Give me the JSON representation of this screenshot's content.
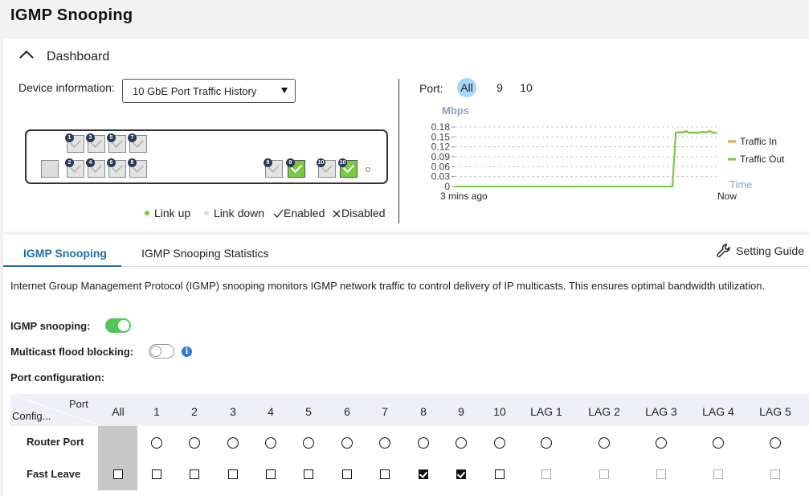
{
  "page_title": "IGMP  Snooping",
  "dashboard": {
    "title": "Dashboard",
    "device_info_label": "Device  information:",
    "device_select_value": "10  GbE  Port  Traffic  History",
    "legend": {
      "link_up": "Link  up",
      "link_down": "Link  down",
      "enabled": "Enabled",
      "disabled": "Disabled"
    },
    "ports": [
      "1",
      "2",
      "3",
      "4",
      "5",
      "6",
      "7",
      "8",
      "9",
      "10"
    ],
    "chart_port_label": "Port:",
    "chart_ports": [
      "All",
      "9",
      "10"
    ]
  },
  "chart_data": {
    "type": "line",
    "ylabel": "Mbps",
    "xlabel": "Time",
    "yticks": [
      "0.18",
      "0.15",
      "0.12",
      "0.09",
      "0.06",
      "0.03",
      "0"
    ],
    "ylim": [
      0,
      0.18
    ],
    "x_start_label": "3 mins ago",
    "x_end_label": "Now",
    "grid": true,
    "legend_position": "right",
    "series": [
      {
        "name": "Traffic In",
        "color": "#e8a33c",
        "values": [
          0,
          0,
          0,
          0,
          0,
          0,
          0,
          0,
          0,
          0,
          0,
          0,
          0,
          0,
          0,
          0,
          0,
          0,
          0,
          0,
          0,
          0,
          0,
          0,
          0,
          0,
          0,
          0,
          0,
          0,
          0,
          0,
          0,
          0,
          0,
          0,
          0,
          0,
          0,
          0,
          0,
          0,
          0,
          0,
          0,
          0,
          0,
          0,
          0,
          0,
          0,
          0,
          0,
          0,
          0,
          0,
          0,
          0,
          0,
          0,
          0,
          0,
          0,
          0,
          0,
          0.163,
          0.165,
          0.164,
          0.168,
          0.163,
          0.164,
          0.163,
          0.164,
          0.166,
          0.164,
          0.168,
          0.163,
          0.163
        ]
      },
      {
        "name": "Traffic Out",
        "color": "#7ac943",
        "values": [
          0,
          0,
          0,
          0,
          0,
          0,
          0,
          0,
          0,
          0,
          0,
          0,
          0,
          0,
          0,
          0,
          0,
          0,
          0,
          0,
          0,
          0,
          0,
          0,
          0,
          0,
          0,
          0,
          0,
          0,
          0,
          0,
          0,
          0,
          0,
          0,
          0,
          0,
          0,
          0,
          0,
          0,
          0,
          0,
          0,
          0,
          0,
          0,
          0,
          0,
          0,
          0,
          0,
          0,
          0,
          0,
          0,
          0,
          0,
          0,
          0,
          0,
          0,
          0,
          0,
          0.162,
          0.164,
          0.163,
          0.167,
          0.162,
          0.163,
          0.162,
          0.163,
          0.165,
          0.163,
          0.167,
          0.162,
          0.162
        ]
      }
    ]
  },
  "tabs": {
    "igmp": "IGMP Snooping",
    "stats": "IGMP Snooping Statistics",
    "guide": "Setting  Guide"
  },
  "description": "Internet Group Management Protocol (IGMP) snooping monitors IGMP network traffic to control delivery of IP multicasts. This ensures optimal bandwidth utilization.",
  "igmp_snooping_label": "IGMP snooping:",
  "flood_blocking_label": "Multicast flood blocking:",
  "port_config_label": "Port configuration:",
  "table": {
    "header_port": "Port",
    "header_config": "Config...",
    "columns": [
      "All",
      "1",
      "2",
      "3",
      "4",
      "5",
      "6",
      "7",
      "8",
      "9",
      "10",
      "LAG  1",
      "LAG  2",
      "LAG  3",
      "LAG  4",
      "LAG  5"
    ],
    "rows": [
      {
        "label": "Router Port"
      },
      {
        "label": "Fast Leave",
        "checked_ports": [
          "8",
          "9"
        ]
      }
    ]
  }
}
